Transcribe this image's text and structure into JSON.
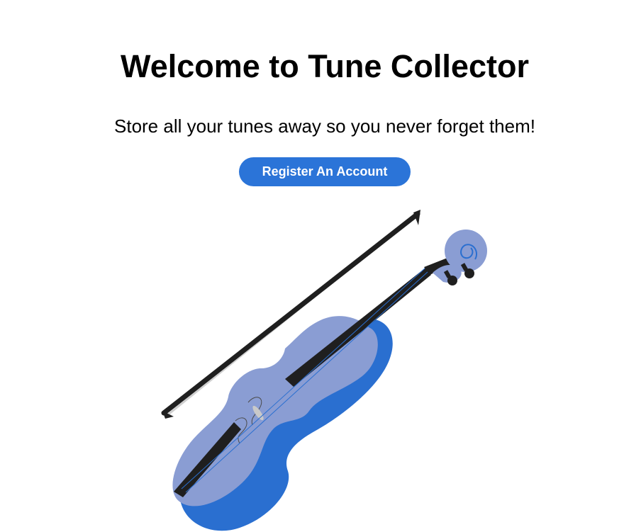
{
  "hero": {
    "title": "Welcome to Tune Collector",
    "subtitle": "Store all your tunes away so you never forget them!",
    "register_label": "Register An Account"
  },
  "illustration": {
    "icon": "violin-icon",
    "colors": {
      "body_light": "#8a9dd3",
      "body_shadow": "#2a6fd0",
      "fingerboard": "#1f1f1f",
      "bow_stick": "#1f1f1f",
      "bow_hair": "#cfcfcf"
    }
  },
  "theme": {
    "accent": "#2b74d8",
    "background": "#ffffff",
    "text": "#000000"
  }
}
